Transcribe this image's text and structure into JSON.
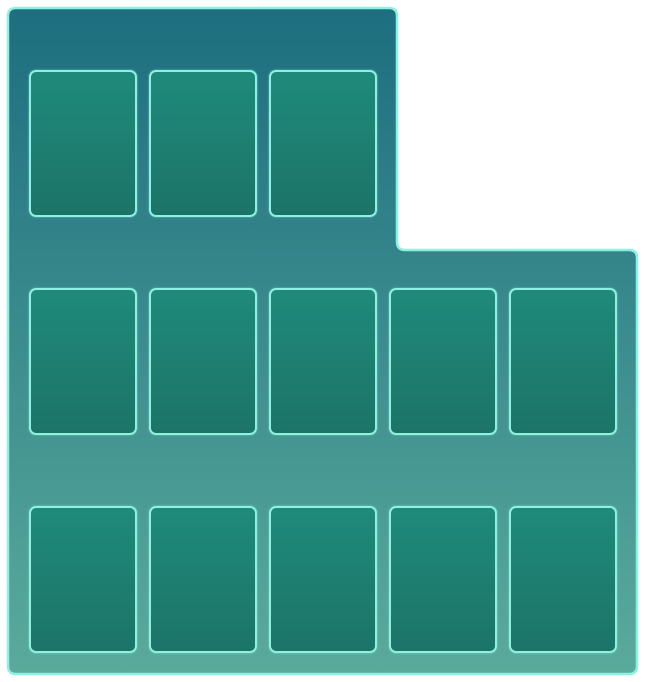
{
  "board": {
    "name": "card-board",
    "colors": {
      "panel_top": "#1d6e7f",
      "panel_bottom": "#5aab9c",
      "border_glow": "#8cf2df",
      "slot_top": "#1f8a7b",
      "slot_bottom": "#1c7467"
    },
    "rows": [
      {
        "id": "row-1",
        "slots": 3,
        "state": "empty"
      },
      {
        "id": "row-2",
        "slots": 5,
        "state": "empty"
      },
      {
        "id": "row-3",
        "slots": 5,
        "state": "empty"
      }
    ]
  }
}
